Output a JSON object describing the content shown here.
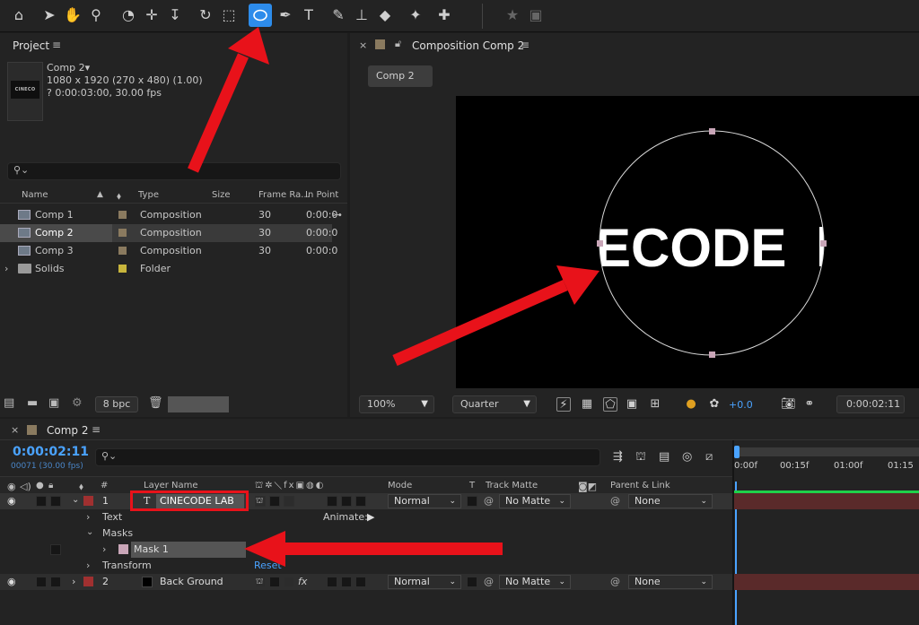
{
  "project": {
    "title": "Project",
    "comp_name": "Comp 2▾",
    "comp_size": "1080 x 1920  (270 x 480) (1.00)",
    "comp_duration": "? 0:00:03:00, 30.00 fps",
    "thumb_text": "CINECO",
    "search_placeholder": "",
    "columns": [
      "Name",
      "Type",
      "Size",
      "Frame Ra...",
      "In Point"
    ],
    "items": [
      {
        "name": "Comp 1",
        "type": "Composition",
        "fps": "30",
        "in": "0:00:0",
        "swatch": "#8a7a5f",
        "selected": false
      },
      {
        "name": "Comp 2",
        "type": "Composition",
        "fps": "30",
        "in": "0:00:0",
        "swatch": "#8a7a5f",
        "selected": true
      },
      {
        "name": "Comp 3",
        "type": "Composition",
        "fps": "30",
        "in": "0:00:0",
        "swatch": "#8a7a5f",
        "selected": false
      },
      {
        "name": "Solids",
        "type": "Folder",
        "fps": "",
        "in": "",
        "swatch": "#c8b53c",
        "selected": false
      }
    ],
    "bpc": "8 bpc"
  },
  "composition": {
    "panel_title": "Composition Comp 2",
    "tab": "Comp 2",
    "viewer_text": "ECODE",
    "zoom": "100%",
    "resolution": "Quarter",
    "exposure": "+0.0",
    "timecode": "0:00:02:11"
  },
  "timeline": {
    "tab": "Comp 2",
    "time": "0:00:02:11",
    "frames": "00071 (30.00 fps)",
    "headers": {
      "hash": "#",
      "layer_name": "Layer Name",
      "mode": "Mode",
      "t": "T",
      "track_matte": "Track Matte",
      "parent": "Parent & Link"
    },
    "ruler": [
      "0:00f",
      "00:15f",
      "01:00f",
      "01:15"
    ],
    "layers": [
      {
        "num": "1",
        "name": "CINECODE LAB",
        "mode": "Normal",
        "matte": "No Matte",
        "parent": "None"
      },
      {
        "num": "2",
        "name": "Back Ground",
        "mode": "Normal",
        "matte": "No Matte",
        "parent": "None"
      }
    ],
    "props": {
      "text": "Text",
      "animate": "Animate:",
      "masks": "Masks",
      "mask1": "Mask 1",
      "transform": "Transform",
      "reset": "Reset"
    }
  },
  "colors": {
    "accent": "#2d8ceb",
    "timecode": "#4aa3ff",
    "annotation": "#e8121a"
  }
}
